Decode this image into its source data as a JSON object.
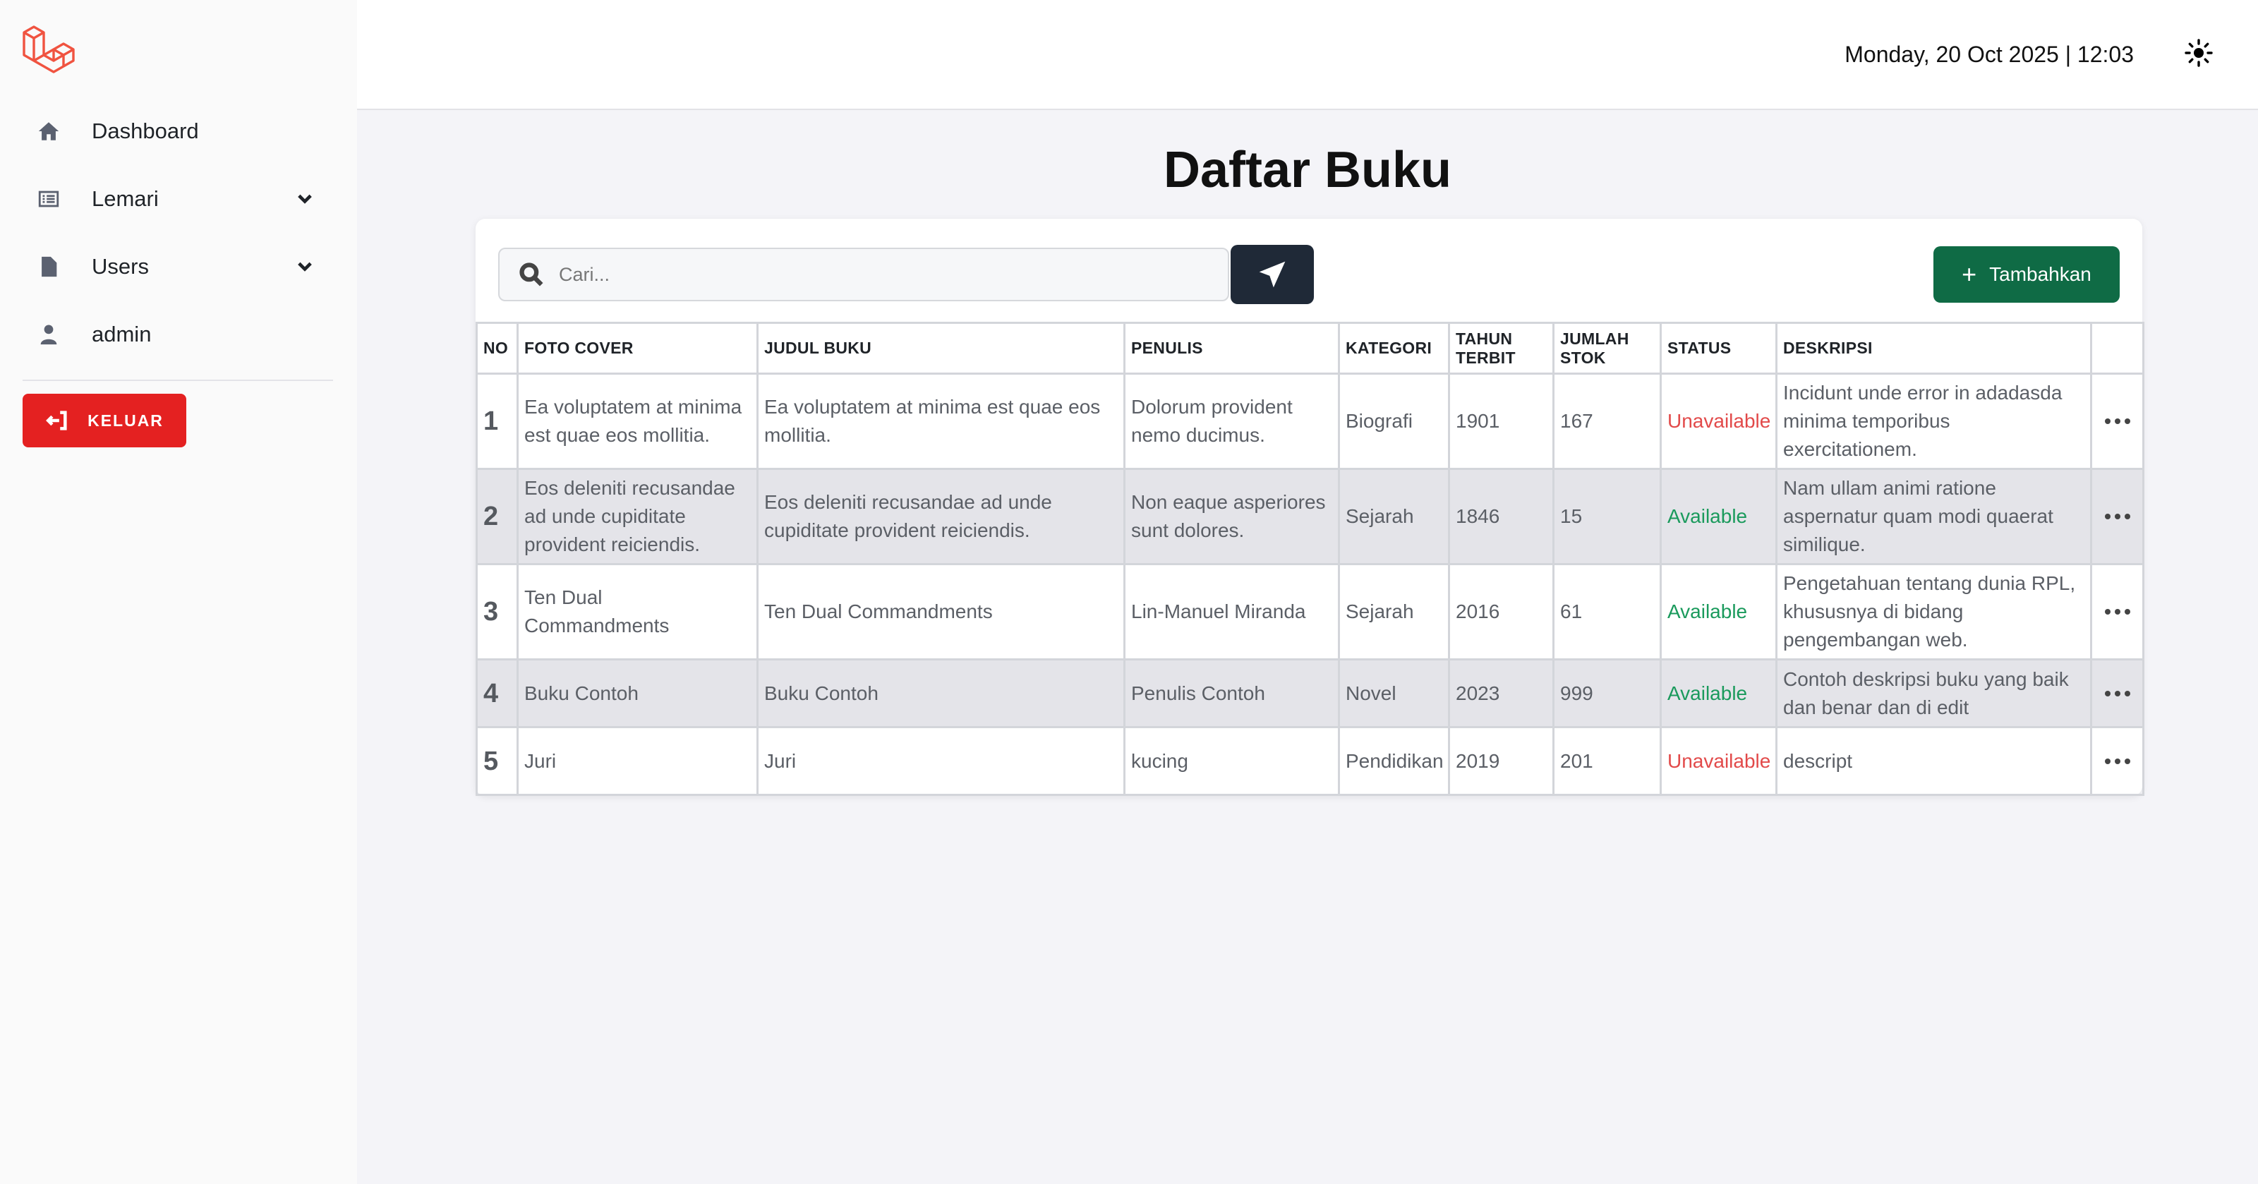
{
  "sidebar": {
    "items": [
      {
        "label": "Dashboard",
        "icon": "home-icon"
      },
      {
        "label": "Lemari",
        "icon": "list-icon"
      },
      {
        "label": "Users",
        "icon": "document-icon"
      },
      {
        "label": "admin",
        "icon": "user-icon"
      }
    ],
    "logout_label": "KELUAR"
  },
  "header": {
    "datetime": "Monday, 20 Oct 2025 | 12:03"
  },
  "page": {
    "title": "Daftar Buku"
  },
  "search": {
    "placeholder": "Cari..."
  },
  "toolbar": {
    "add_label": "Tambahkan"
  },
  "colors": {
    "logout": "#e42121",
    "add": "#0f6b45",
    "send": "#1f2937",
    "available": "#1a9a5c",
    "unavailable": "#e24a4a"
  },
  "table": {
    "headers": {
      "no": "NO",
      "cover": "FOTO COVER",
      "judul": "JUDUL BUKU",
      "penulis": "PENULIS",
      "kategori": "KATEGORI",
      "tahun_1": "TAHUN",
      "tahun_2": "TERBIT",
      "stok_1": "JUMLAH",
      "stok_2": "STOK",
      "status": "STATUS",
      "deskripsi": "DESKRIPSI"
    },
    "rows": [
      {
        "no": "1",
        "cover": "Ea voluptatem at minima est quae eos mollitia.",
        "judul": "Ea voluptatem at minima est quae eos mollitia.",
        "penulis": "Dolorum provident nemo ducimus.",
        "kategori": "Biografi",
        "tahun": "1901",
        "stok": "167",
        "status": "Unavailable",
        "deskripsi": "Incidunt unde error in adadasda minima temporibus exercitationem."
      },
      {
        "no": "2",
        "cover": "Eos deleniti recusandae ad unde cupiditate provident reiciendis.",
        "judul": "Eos deleniti recusandae ad unde cupiditate provident reiciendis.",
        "penulis": "Non eaque asperiores sunt dolores.",
        "kategori": "Sejarah",
        "tahun": "1846",
        "stok": "15",
        "status": "Available",
        "deskripsi": "Nam ullam animi ratione aspernatur quam modi quaerat similique."
      },
      {
        "no": "3",
        "cover": "Ten Dual Commandments",
        "judul": "Ten Dual Commandments",
        "penulis": "Lin-Manuel Miranda",
        "kategori": "Sejarah",
        "tahun": "2016",
        "stok": "61",
        "status": "Available",
        "deskripsi": "Pengetahuan tentang dunia RPL, khususnya di bidang pengembangan web."
      },
      {
        "no": "4",
        "cover": "Buku Contoh",
        "judul": "Buku Contoh",
        "penulis": "Penulis Contoh",
        "kategori": "Novel",
        "tahun": "2023",
        "stok": "999",
        "status": "Available",
        "deskripsi": "Contoh deskripsi buku yang baik dan benar dan di edit"
      },
      {
        "no": "5",
        "cover": "Juri",
        "judul": "Juri",
        "penulis": "kucing",
        "kategori": "Pendidikan",
        "tahun": "2019",
        "stok": "201",
        "status": "Unavailable",
        "deskripsi": "descript"
      }
    ]
  }
}
